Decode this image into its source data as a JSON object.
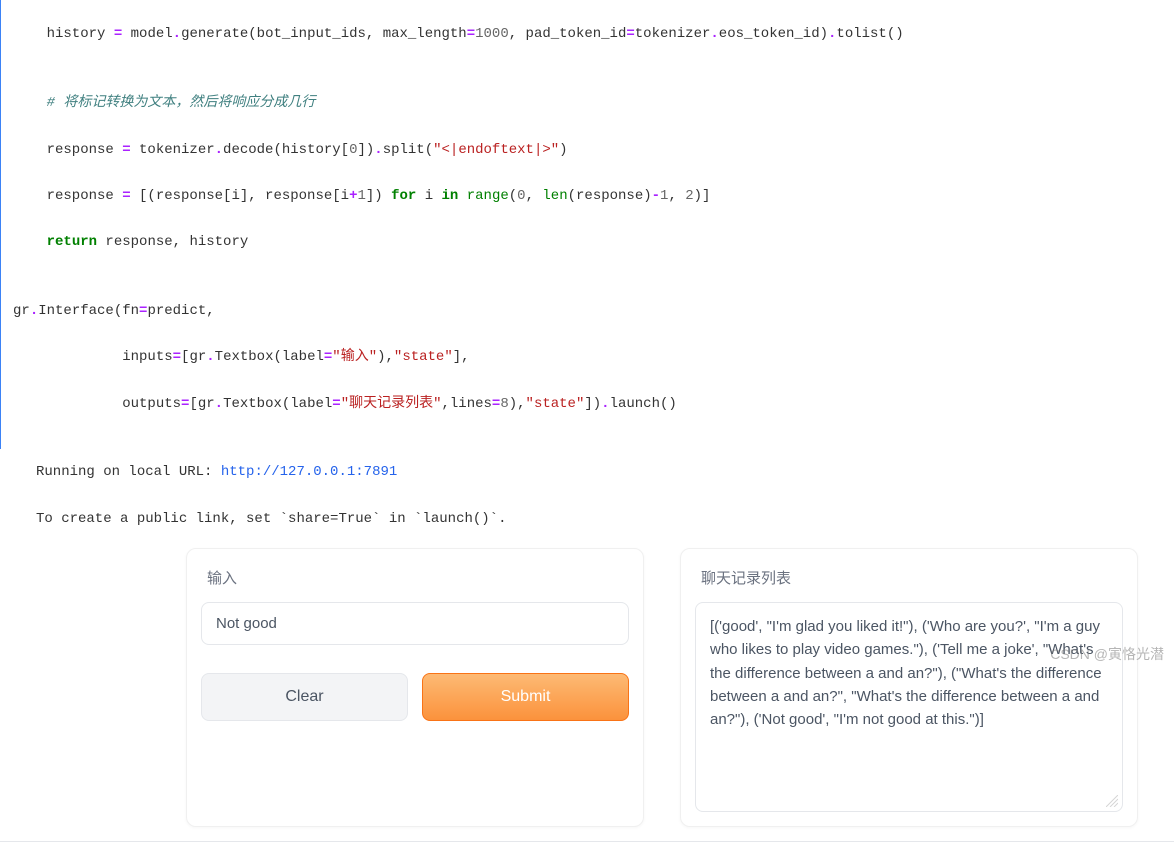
{
  "code": {
    "l1_a": "    history ",
    "l1_b": "=",
    "l1_c": " model",
    "l1_d": ".",
    "l1_e": "generate(bot_input_ids, max_length",
    "l1_f": "=",
    "l1_g": "1000",
    "l1_h": ", pad_token_id",
    "l1_i": "=",
    "l1_j": "tokenizer",
    "l1_k": ".",
    "l1_l": "eos_token_id)",
    "l1_m": ".",
    "l1_n": "tolist()",
    "l2": "",
    "l3": "    # 将标记转换为文本，然后将响应分成几行",
    "l4_a": "    response ",
    "l4_b": "=",
    "l4_c": " tokenizer",
    "l4_d": ".",
    "l4_e": "decode(history[",
    "l4_f": "0",
    "l4_g": "])",
    "l4_h": ".",
    "l4_i": "split(",
    "l4_j": "\"<|endoftext|>\"",
    "l4_k": ")",
    "l5_a": "    response ",
    "l5_b": "=",
    "l5_c": " [(response[i], response[i",
    "l5_d": "+",
    "l5_e": "1",
    "l5_f": "]) ",
    "l5_g": "for",
    "l5_h": " i ",
    "l5_i": "in",
    "l5_j": " ",
    "l5_k": "range",
    "l5_l": "(",
    "l5_m": "0",
    "l5_n": ", ",
    "l5_o": "len",
    "l5_p": "(response)",
    "l5_q": "-",
    "l5_r": "1",
    "l5_s": ", ",
    "l5_t": "2",
    "l5_u": ")]",
    "l6_a": "    ",
    "l6_b": "return",
    "l6_c": " response, history",
    "l7": "",
    "l8_a": "gr",
    "l8_b": ".",
    "l8_c": "Interface(fn",
    "l8_d": "=",
    "l8_e": "predict,",
    "l9_a": "             inputs",
    "l9_b": "=",
    "l9_c": "[gr",
    "l9_d": ".",
    "l9_e": "Textbox(label",
    "l9_f": "=",
    "l9_g": "\"输入\"",
    "l9_h": "),",
    "l9_i": "\"state\"",
    "l9_j": "],",
    "l10_a": "             outputs",
    "l10_b": "=",
    "l10_c": "[gr",
    "l10_d": ".",
    "l10_e": "Textbox(label",
    "l10_f": "=",
    "l10_g": "\"聊天记录列表\"",
    "l10_h": ",lines",
    "l10_i": "=",
    "l10_j": "8",
    "l10_k": "),",
    "l10_l": "\"state\"",
    "l10_m": "])",
    "l10_n": ".",
    "l10_o": "launch()"
  },
  "output": {
    "running_label": "Running on local URL:  ",
    "url": "http://127.0.0.1:7891",
    "share_hint": "To create a public link, set `share=True` in `launch()`."
  },
  "gradio": {
    "input": {
      "label": "输入",
      "value": "Not good"
    },
    "output": {
      "label": "聊天记录列表",
      "value": "[('good', \"I'm glad you liked it!\"), ('Who are you?', \"I'm a guy who likes to play video games.\"), ('Tell me a joke', \"What's the difference between a and an?\"), (\"What's the difference between a and an?\", \"What's the difference between a and an?\"), ('Not good', \"I'm not good at this.\")]"
    },
    "buttons": {
      "clear": "Clear",
      "submit": "Submit"
    }
  },
  "watermark": "CSDN @寅恪光潜"
}
